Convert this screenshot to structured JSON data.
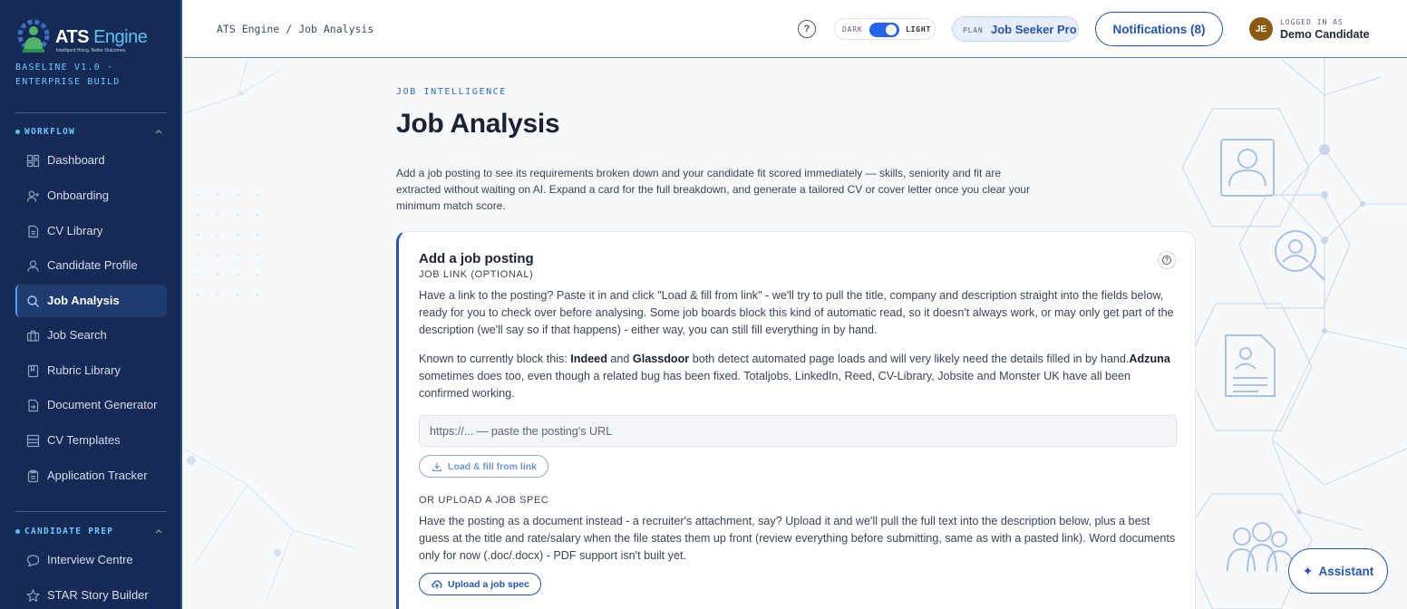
{
  "brand": {
    "name_part1": "ATS",
    "name_part2": "Engine",
    "tagline": "Intelligent Hiring. Better Outcomes.",
    "build_line1": "BASELINE V1.0 ·",
    "build_line2": "ENTERPRISE BUILD"
  },
  "sidebar": {
    "workflow_label": "WORKFLOW",
    "candidate_prep_label": "CANDIDATE PREP",
    "workflow_items": [
      {
        "label": "Dashboard",
        "icon": "dashboard-grid-icon"
      },
      {
        "label": "Onboarding",
        "icon": "user-plus-icon"
      },
      {
        "label": "CV Library",
        "icon": "document-icon"
      },
      {
        "label": "Candidate Profile",
        "icon": "user-icon"
      },
      {
        "label": "Job Analysis",
        "icon": "search-icon",
        "active": true
      },
      {
        "label": "Job Search",
        "icon": "briefcase-icon"
      },
      {
        "label": "Rubric Library",
        "icon": "bookmark-icon"
      },
      {
        "label": "Document Generator",
        "icon": "file-arrow-icon"
      },
      {
        "label": "CV Templates",
        "icon": "layout-icon"
      },
      {
        "label": "Application Tracker",
        "icon": "clipboard-icon"
      }
    ],
    "prep_items": [
      {
        "label": "Interview Centre",
        "icon": "chat-bubble-icon"
      },
      {
        "label": "STAR Story Builder",
        "icon": "star-icon"
      }
    ]
  },
  "topbar": {
    "breadcrumb_root": "ATS Engine",
    "breadcrumb_sep": "/",
    "breadcrumb_current": "Job Analysis",
    "help_glyph": "?",
    "theme_dark": "DARK",
    "theme_light": "LIGHT",
    "plan_key": "PLAN",
    "plan_value": "Job Seeker Pro",
    "notifications": "Notifications (8)",
    "avatar_initials": "JE",
    "logged_in_key": "LOGGED IN AS",
    "user_name": "Demo Candidate"
  },
  "main": {
    "kicker": "JOB INTELLIGENCE",
    "title": "Job Analysis",
    "intro": "Add a job posting to see its requirements broken down and your candidate fit scored immediately — skills, seniority and fit are extracted without waiting on AI. Expand a card for the full breakdown, and generate a tailored CV or cover letter once you clear your minimum match score."
  },
  "card": {
    "title": "Add a job posting",
    "help_glyph": "?",
    "link_label": "JOB LINK (OPTIONAL)",
    "link_para": "Have a link to the posting? Paste it in and click \"Load & fill from link\" - we'll try to pull the title, company and description straight into the fields below, ready for you to check over before analysing. Some job boards block this kind of automatic read, so it doesn't always work, or may only get part of the description (we'll say so if that happens) - either way, you can still fill everything in by hand.",
    "block_intro": "Known to currently block this: ",
    "block_site1": "Indeed",
    "block_and": " and ",
    "block_site2": "Glassdoor",
    "block_mid": " both detect automated page loads and will very likely need the details filled in by hand.",
    "block_site3": "Adzuna",
    "block_tail": " sometimes does too, even though a related bug has been fixed. Totaljobs, LinkedIn, Reed, CV-Library, Jobsite and Monster UK have all been confirmed working.",
    "url_placeholder": "https://... — paste the posting's URL",
    "load_button": "Load & fill from link",
    "upload_label": "OR UPLOAD A JOB SPEC",
    "upload_para": "Have the posting as a document instead - a recruiter's attachment, say? Upload it and we'll pull the full text into the description below, plus a best guess at the title and rate/salary when the file states them up front (review everything before submitting, same as with a pasted link). Word documents only for now (.doc/.docx) - PDF support isn't built yet.",
    "upload_button": "Upload a job spec"
  },
  "assistant": {
    "glyph": "✦",
    "label": "Assistant"
  },
  "colors": {
    "sidebar_bg": "#152a55",
    "accent": "#2454b8",
    "cyan_accent": "#5cc2f2",
    "avatar_bg": "#8a5a12"
  }
}
